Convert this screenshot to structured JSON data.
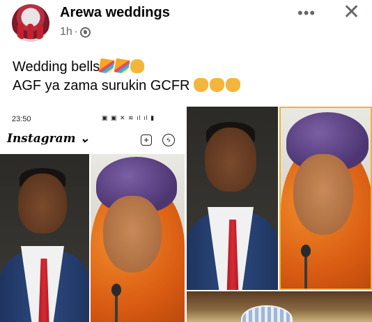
{
  "post": {
    "page_name": "Arewa weddings",
    "time": "1h",
    "dot": "·",
    "caption_line1": "Wedding bells",
    "caption_line2": "AGF ya zama surukin GCFR",
    "more_icon": "more-horizontal-icon",
    "close_icon": "close-icon"
  },
  "embedded_screenshot": {
    "status_time": "23:50",
    "app_name": "Instagram"
  },
  "colors": {
    "meta_grey": "#65676b",
    "turban_purple": "#5b3f86",
    "scarf_orange": "#e06a18",
    "tie_red": "#c81f2a",
    "suit_blue": "#24406e"
  }
}
